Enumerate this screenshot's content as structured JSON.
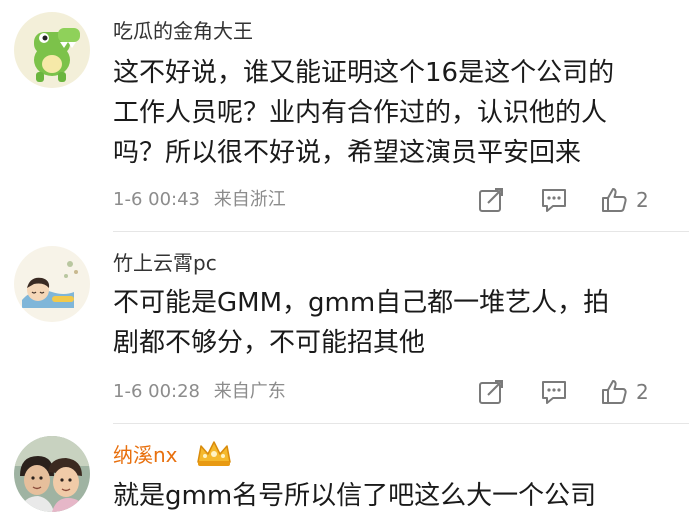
{
  "comments": [
    {
      "username": "吃瓜的金角大王",
      "content_lines": [
        "这不好说，谁又能证明这个16是这个公司的",
        "工作人员呢？业内有合作过的，认识他的人",
        "吗？所以很不好说，希望这演员平安回来"
      ],
      "date": "1-6 00:43",
      "location": "来自浙江",
      "likes": "2",
      "avatar_icon": "green-crocodile-avatar"
    },
    {
      "username": "竹上云霄pc",
      "content_lines": [
        "不可能是GMM，gmm自己都一堆艺人，拍",
        "剧都不够分，不可能招其他"
      ],
      "date": "1-6 00:28",
      "location": "来自广东",
      "likes": "2",
      "avatar_icon": "sleeping-girl-avatar"
    },
    {
      "username": "纳溪nx",
      "content_lines": [
        "就是gmm名号所以信了吧这么大一个公司"
      ],
      "avatar_icon": "two-people-photo-avatar",
      "badge_icon": "vip-crown-icon",
      "username_color": "#e8700e"
    }
  ],
  "icons": {
    "repost": "repost-edit-icon",
    "reply": "reply-comment-icon",
    "like": "thumbs-up-icon"
  },
  "colors": {
    "text": "#1a1a1a",
    "meta": "#8c8c8c",
    "vip_name": "#e8700e"
  }
}
